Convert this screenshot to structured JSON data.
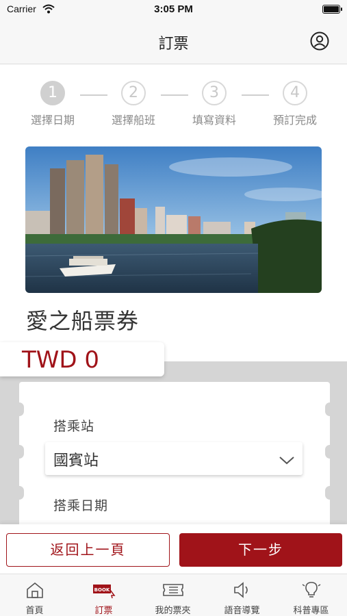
{
  "status_bar": {
    "carrier": "Carrier",
    "time": "3:05 PM"
  },
  "header": {
    "title": "訂票",
    "profile_icon": "user-circle-icon"
  },
  "stepper": {
    "steps": [
      {
        "number": "1",
        "label": "選擇日期",
        "active": true
      },
      {
        "number": "2",
        "label": "選擇船班",
        "active": false
      },
      {
        "number": "3",
        "label": "填寫資料",
        "active": false
      },
      {
        "number": "4",
        "label": "預訂完成",
        "active": false
      }
    ]
  },
  "product": {
    "title": "愛之船票券",
    "price": "TWD 0"
  },
  "form": {
    "station_label": "搭乘站",
    "station_value": "國賓站",
    "date_label": "搭乘日期"
  },
  "actions": {
    "back_label": "返回上一頁",
    "next_label": "下一步"
  },
  "tabs": [
    {
      "label": "首頁",
      "icon": "home-icon",
      "active": false
    },
    {
      "label": "訂票",
      "icon": "book-ticket-icon",
      "icon_text": "BOOK",
      "active": true
    },
    {
      "label": "我的票夾",
      "icon": "ticket-wallet-icon",
      "active": false
    },
    {
      "label": "語音導覽",
      "icon": "speaker-icon",
      "active": false
    },
    {
      "label": "科普專區",
      "icon": "lightbulb-icon",
      "active": false
    }
  ],
  "colors": {
    "brand": "#a01319",
    "panel": "#d5d5d5"
  }
}
